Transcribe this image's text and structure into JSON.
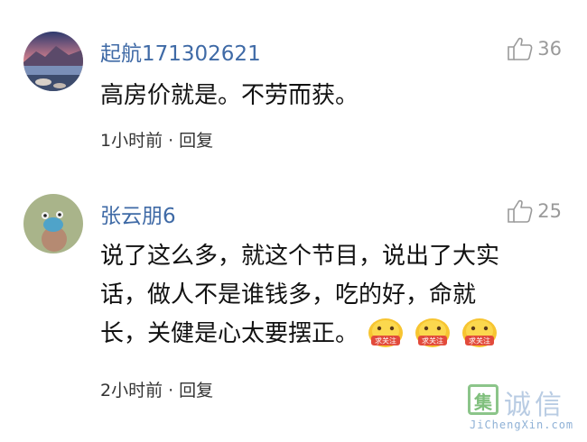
{
  "comments": [
    {
      "username": "起航171302621",
      "likes": "36",
      "text": "高房价就是。不劳而获。",
      "time": "1小时前",
      "separator": "·",
      "reply": "回复"
    },
    {
      "username": "张云朋6",
      "likes": "25",
      "text_lines": [
        "说了这么多，就这个节目，说出了大实",
        "话，做人不是谁钱多，吃的好，命就",
        "长，关健是心太要摆正。"
      ],
      "emoji_label": "求关注",
      "time": "2小时前",
      "separator": "·",
      "reply": "回复"
    }
  ],
  "watermark": {
    "box_char": "集",
    "chars": "诚信",
    "url": "JiChengXin.com"
  },
  "colors": {
    "username": "#3f6aa6",
    "like_gray": "#9a9a9a"
  }
}
